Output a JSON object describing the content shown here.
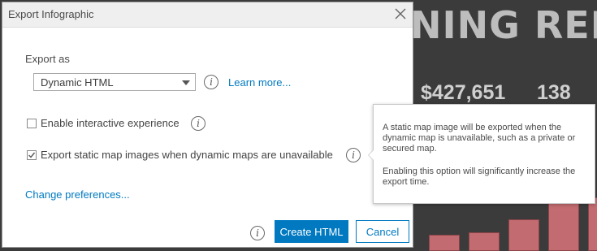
{
  "background": {
    "title_fragment": "NING REPO",
    "stats": [
      "$427,651",
      "138"
    ]
  },
  "dialog": {
    "title": "Export Infographic",
    "export_as_label": "Export as",
    "format_selected": "Dynamic HTML",
    "learn_more": "Learn more...",
    "options": [
      {
        "label": "Enable interactive experience",
        "checked": false
      },
      {
        "label": "Export static map images when dynamic maps are unavailable",
        "checked": true
      }
    ],
    "change_preferences": "Change preferences...",
    "create_button": "Create HTML",
    "cancel_button": "Cancel"
  },
  "tooltip": {
    "paragraph1": "A static map image will be exported when the dynamic map is unavailable, such as a private or secured map.",
    "paragraph2": "Enabling this option will significantly increase the export time."
  },
  "colors": {
    "accent": "#0079c1",
    "bar": "#c26b70"
  }
}
